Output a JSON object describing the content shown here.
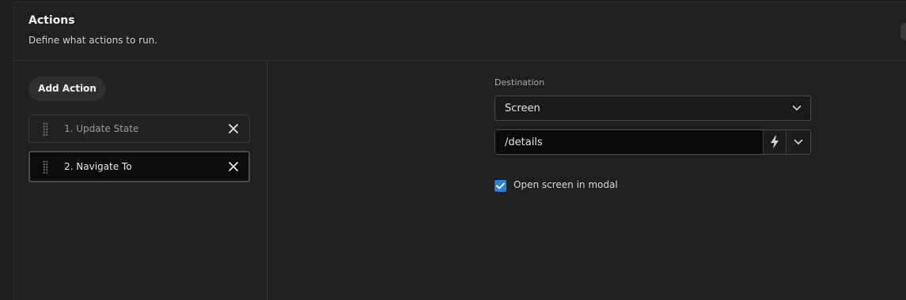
{
  "header": {
    "title": "Actions",
    "description": "Define what actions to run."
  },
  "sidebar": {
    "add_action_label": "Add Action",
    "items": [
      {
        "label": "1. Update State",
        "selected": false
      },
      {
        "label": "2. Navigate To",
        "selected": true
      }
    ]
  },
  "destination": {
    "label": "Destination",
    "type_value": "Screen",
    "path_value": "/details"
  },
  "modal_option": {
    "label": "Open screen in modal",
    "checked": true
  },
  "colors": {
    "background": "#1e1e1e",
    "checkbox_accent": "#2f7fd9",
    "selected_item_bg": "#0c0c0c"
  },
  "icons": {
    "drag": "drag-handle-icon",
    "remove": "close-icon",
    "dropdown": "chevron-down-icon",
    "dynamic_value": "lightning-bolt-icon",
    "check": "checkmark-icon"
  }
}
